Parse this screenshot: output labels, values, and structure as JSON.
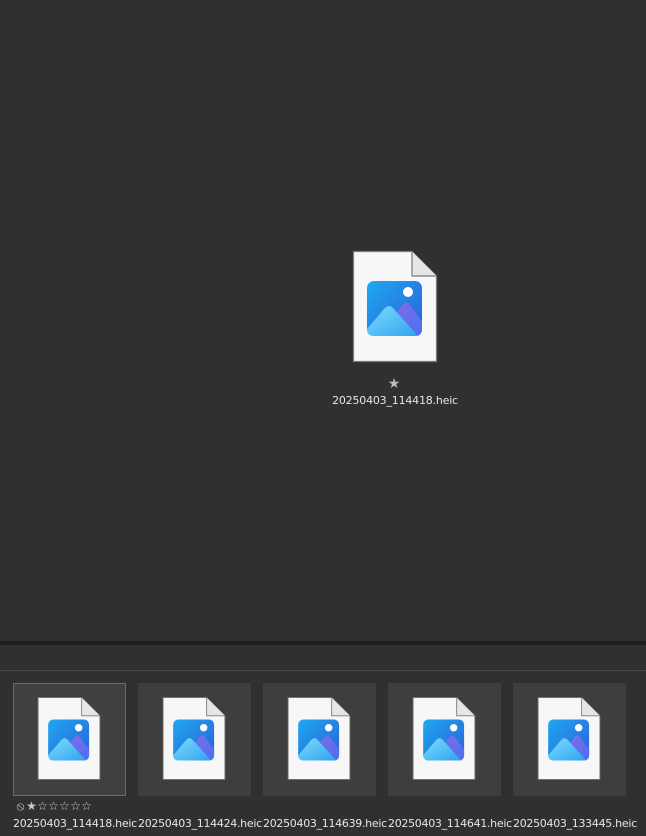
{
  "preview": {
    "file_name": "20250403_114418.heic",
    "star_glyph": "★",
    "file_icon": "image-file-icon"
  },
  "filmstrip": {
    "items": [
      {
        "file_name": "20250403_114418.heic",
        "selected": true,
        "file_icon": "image-file-icon"
      },
      {
        "file_name": "20250403_114424.heic",
        "selected": false,
        "file_icon": "image-file-icon"
      },
      {
        "file_name": "20250403_114639.heic",
        "selected": false,
        "file_icon": "image-file-icon"
      },
      {
        "file_name": "20250403_114641.heic",
        "selected": false,
        "file_icon": "image-file-icon"
      },
      {
        "file_name": "20250403_133445.heic",
        "selected": false,
        "file_icon": "image-file-icon"
      }
    ],
    "rating": {
      "reject_glyph": "⦸",
      "filled_star": "★",
      "empty_star": "☆",
      "stars": 1,
      "max_stars": 6
    }
  },
  "colors": {
    "background": "#303030",
    "thumb_background": "#3e3e3e",
    "selection_border": "#2f72d8"
  }
}
